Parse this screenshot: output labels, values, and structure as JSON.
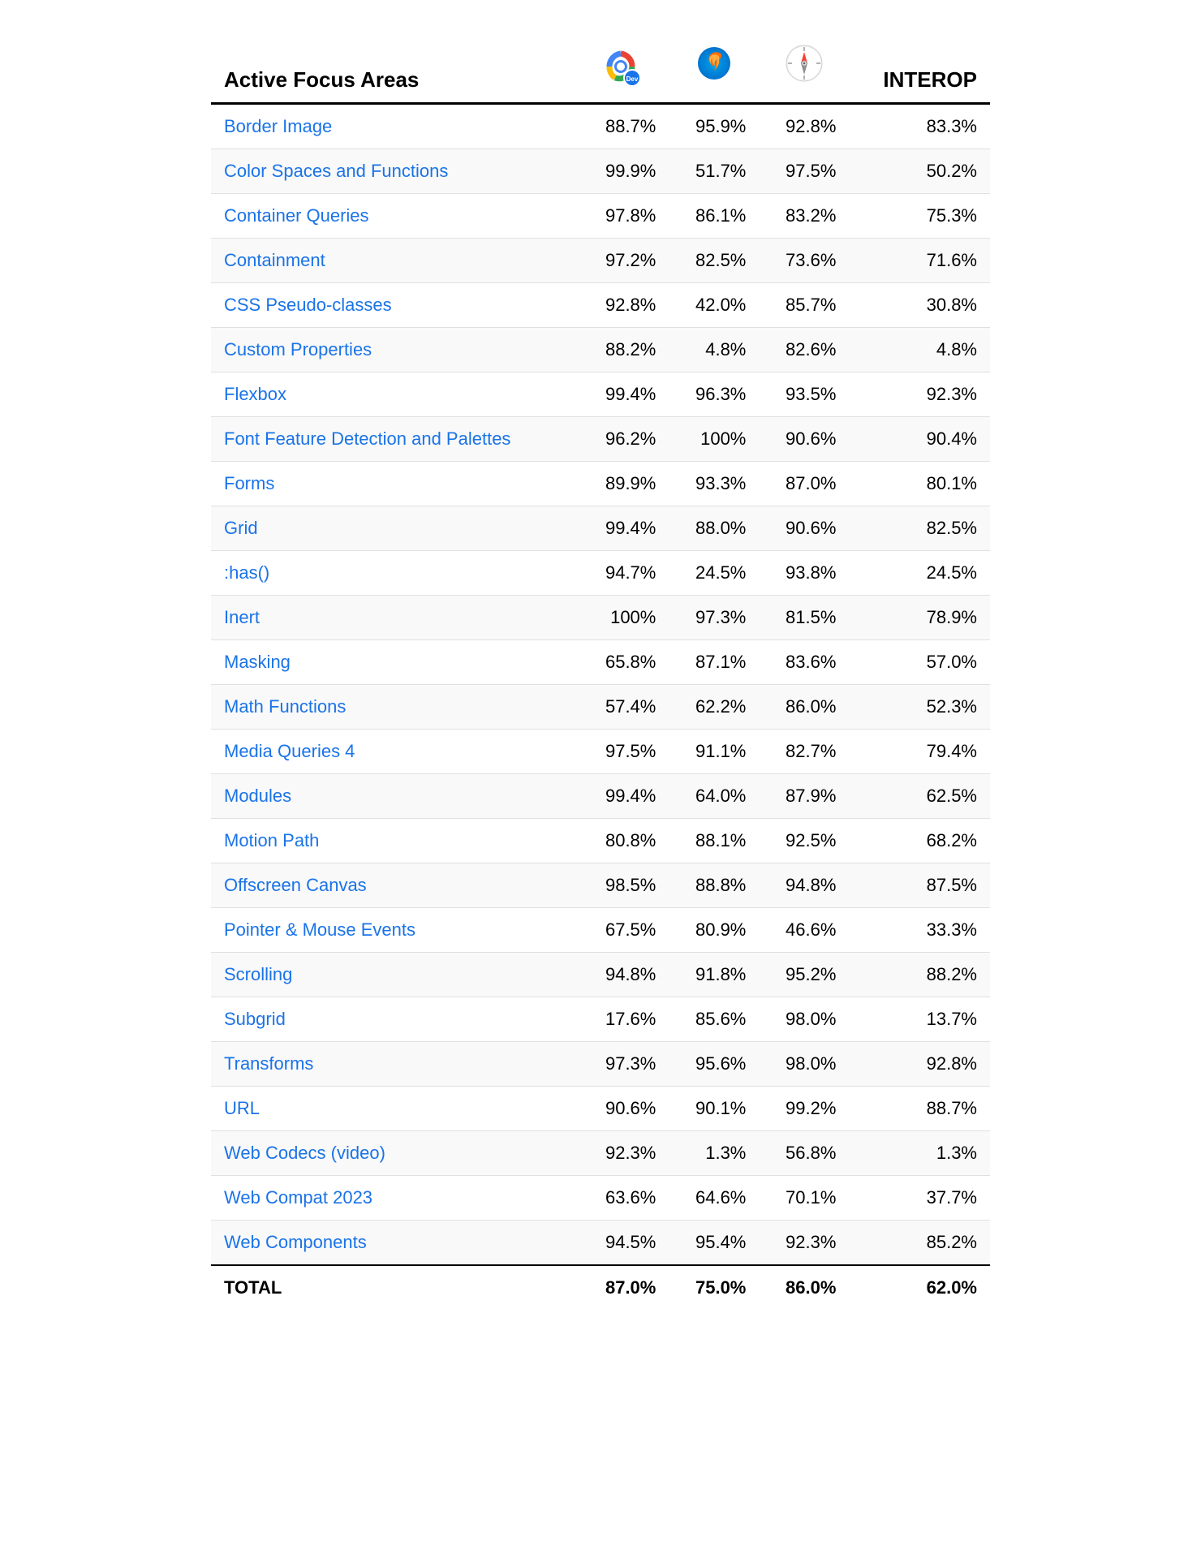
{
  "table": {
    "header": {
      "col1": "Active Focus Areas",
      "col2_label": "Chrome Dev",
      "col3_label": "Firefox",
      "col4_label": "Safari",
      "col5": "INTEROP"
    },
    "rows": [
      {
        "name": "Border Image",
        "chrome": "88.7%",
        "firefox": "95.9%",
        "safari": "92.8%",
        "interop": "83.3%"
      },
      {
        "name": "Color Spaces and Functions",
        "chrome": "99.9%",
        "firefox": "51.7%",
        "safari": "97.5%",
        "interop": "50.2%"
      },
      {
        "name": "Container Queries",
        "chrome": "97.8%",
        "firefox": "86.1%",
        "safari": "83.2%",
        "interop": "75.3%"
      },
      {
        "name": "Containment",
        "chrome": "97.2%",
        "firefox": "82.5%",
        "safari": "73.6%",
        "interop": "71.6%"
      },
      {
        "name": "CSS Pseudo-classes",
        "chrome": "92.8%",
        "firefox": "42.0%",
        "safari": "85.7%",
        "interop": "30.8%"
      },
      {
        "name": "Custom Properties",
        "chrome": "88.2%",
        "firefox": "4.8%",
        "safari": "82.6%",
        "interop": "4.8%"
      },
      {
        "name": "Flexbox",
        "chrome": "99.4%",
        "firefox": "96.3%",
        "safari": "93.5%",
        "interop": "92.3%"
      },
      {
        "name": "Font Feature Detection and Palettes",
        "chrome": "96.2%",
        "firefox": "100%",
        "safari": "90.6%",
        "interop": "90.4%"
      },
      {
        "name": "Forms",
        "chrome": "89.9%",
        "firefox": "93.3%",
        "safari": "87.0%",
        "interop": "80.1%"
      },
      {
        "name": "Grid",
        "chrome": "99.4%",
        "firefox": "88.0%",
        "safari": "90.6%",
        "interop": "82.5%"
      },
      {
        "name": ":has()",
        "chrome": "94.7%",
        "firefox": "24.5%",
        "safari": "93.8%",
        "interop": "24.5%"
      },
      {
        "name": "Inert",
        "chrome": "100%",
        "firefox": "97.3%",
        "safari": "81.5%",
        "interop": "78.9%"
      },
      {
        "name": "Masking",
        "chrome": "65.8%",
        "firefox": "87.1%",
        "safari": "83.6%",
        "interop": "57.0%"
      },
      {
        "name": "Math Functions",
        "chrome": "57.4%",
        "firefox": "62.2%",
        "safari": "86.0%",
        "interop": "52.3%"
      },
      {
        "name": "Media Queries 4",
        "chrome": "97.5%",
        "firefox": "91.1%",
        "safari": "82.7%",
        "interop": "79.4%"
      },
      {
        "name": "Modules",
        "chrome": "99.4%",
        "firefox": "64.0%",
        "safari": "87.9%",
        "interop": "62.5%"
      },
      {
        "name": "Motion Path",
        "chrome": "80.8%",
        "firefox": "88.1%",
        "safari": "92.5%",
        "interop": "68.2%"
      },
      {
        "name": "Offscreen Canvas",
        "chrome": "98.5%",
        "firefox": "88.8%",
        "safari": "94.8%",
        "interop": "87.5%"
      },
      {
        "name": "Pointer & Mouse Events",
        "chrome": "67.5%",
        "firefox": "80.9%",
        "safari": "46.6%",
        "interop": "33.3%"
      },
      {
        "name": "Scrolling",
        "chrome": "94.8%",
        "firefox": "91.8%",
        "safari": "95.2%",
        "interop": "88.2%"
      },
      {
        "name": "Subgrid",
        "chrome": "17.6%",
        "firefox": "85.6%",
        "safari": "98.0%",
        "interop": "13.7%"
      },
      {
        "name": "Transforms",
        "chrome": "97.3%",
        "firefox": "95.6%",
        "safari": "98.0%",
        "interop": "92.8%"
      },
      {
        "name": "URL",
        "chrome": "90.6%",
        "firefox": "90.1%",
        "safari": "99.2%",
        "interop": "88.7%"
      },
      {
        "name": "Web Codecs (video)",
        "chrome": "92.3%",
        "firefox": "1.3%",
        "safari": "56.8%",
        "interop": "1.3%"
      },
      {
        "name": "Web Compat 2023",
        "chrome": "63.6%",
        "firefox": "64.6%",
        "safari": "70.1%",
        "interop": "37.7%"
      },
      {
        "name": "Web Components",
        "chrome": "94.5%",
        "firefox": "95.4%",
        "safari": "92.3%",
        "interop": "85.2%"
      }
    ],
    "footer": {
      "label": "TOTAL",
      "chrome": "87.0%",
      "firefox": "75.0%",
      "safari": "86.0%",
      "interop": "62.0%"
    }
  }
}
